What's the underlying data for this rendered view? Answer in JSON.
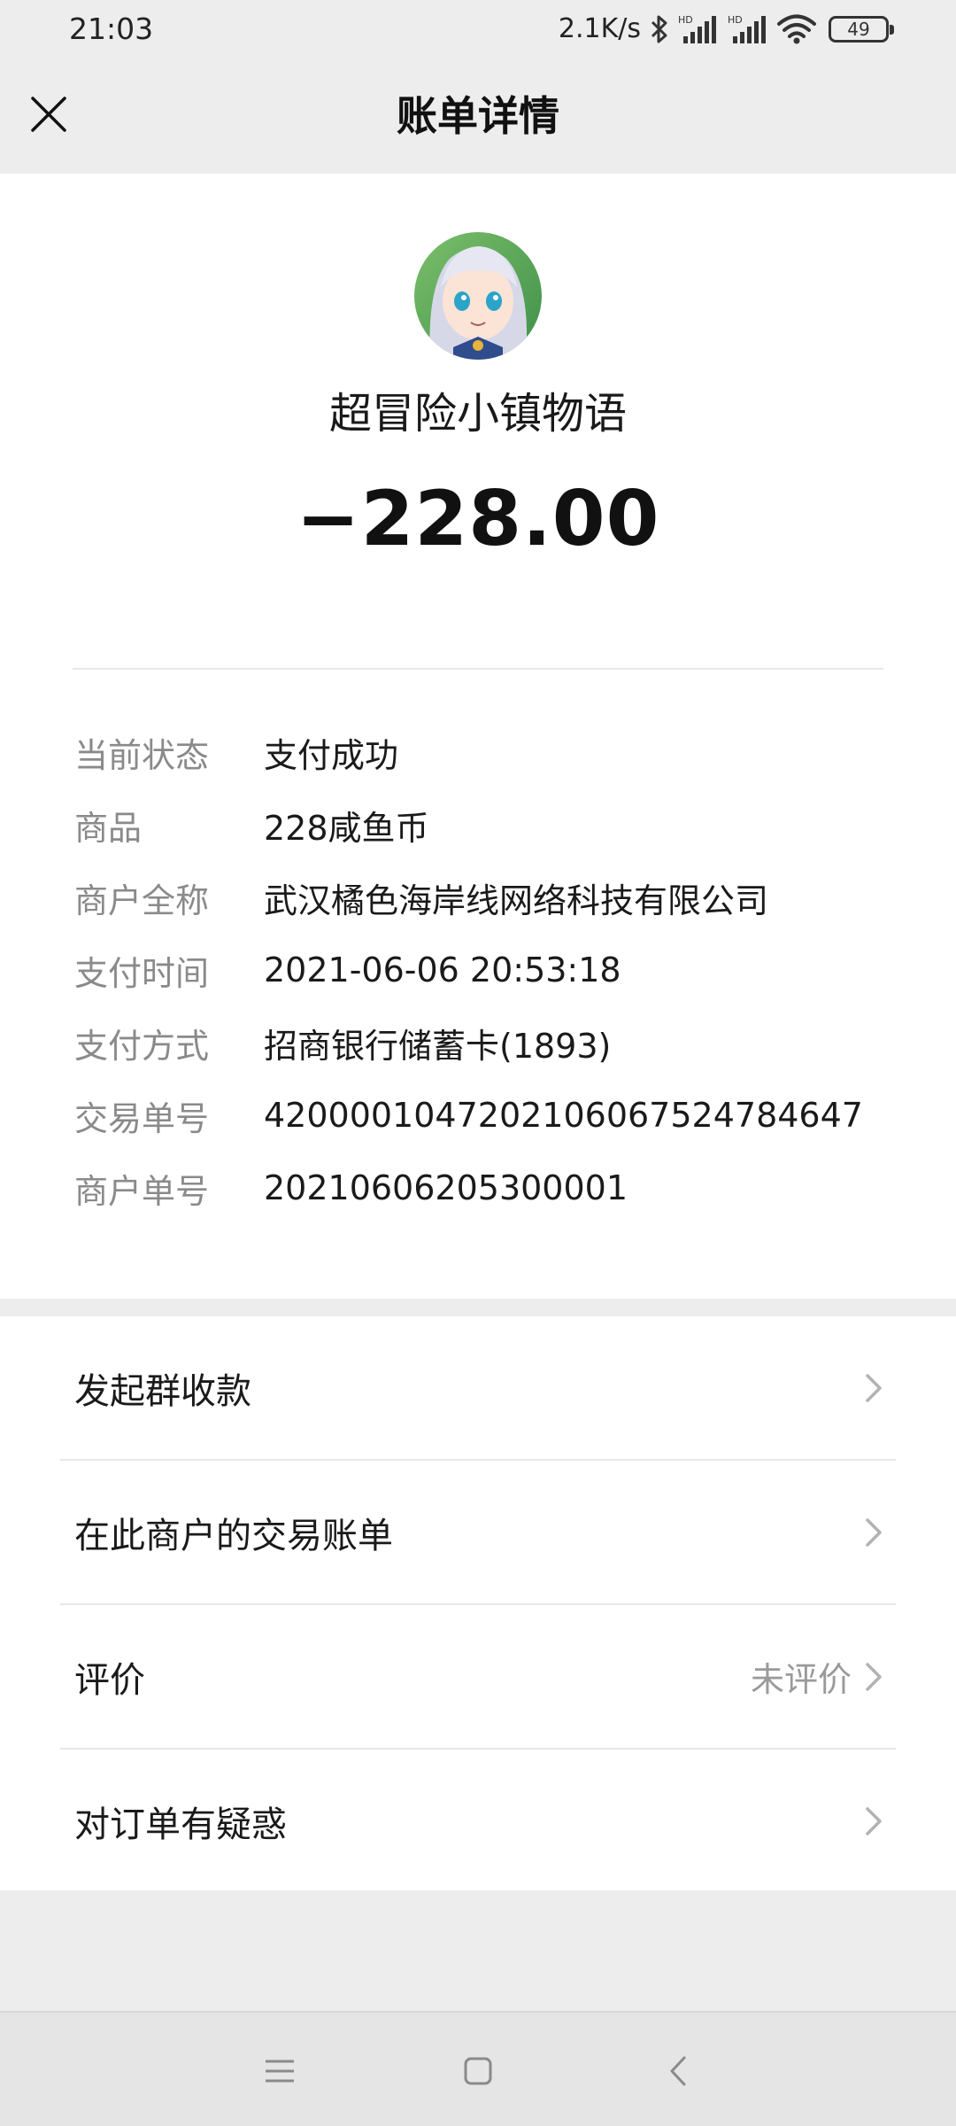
{
  "status_bar": {
    "time": "21:03",
    "network_speed": "2.1K/s",
    "battery_level": "49",
    "icons": [
      "bluetooth-icon",
      "signal-hd-icon",
      "signal-hd-icon",
      "wifi-icon",
      "battery-icon"
    ]
  },
  "nav": {
    "title": "账单详情",
    "close_icon": "close-icon"
  },
  "bill": {
    "merchant_display_name": "超冒险小镇物语",
    "amount": "−228.00",
    "avatar_icon": "merchant-avatar"
  },
  "details": [
    {
      "label": "当前状态",
      "value": "支付成功"
    },
    {
      "label": "商品",
      "value": "228咸鱼币"
    },
    {
      "label": "商户全称",
      "value": "武汉橘色海岸线网络科技有限公司"
    },
    {
      "label": "支付时间",
      "value": "2021-06-06 20:53:18"
    },
    {
      "label": "支付方式",
      "value": "招商银行储蓄卡(1893)"
    },
    {
      "label": "交易单号",
      "value": "4200001047202106067524784647"
    },
    {
      "label": "商户单号",
      "value": "20210606205300001"
    }
  ],
  "actions": [
    {
      "label": "发起群收款",
      "extra": ""
    },
    {
      "label": "在此商户的交易账单",
      "extra": ""
    },
    {
      "label": "评价",
      "extra": "未评价"
    },
    {
      "label": "对订单有疑惑",
      "extra": ""
    }
  ],
  "system_nav": {
    "menu_icon": "menu-icon",
    "home_icon": "home-icon",
    "back_icon": "back-icon"
  }
}
